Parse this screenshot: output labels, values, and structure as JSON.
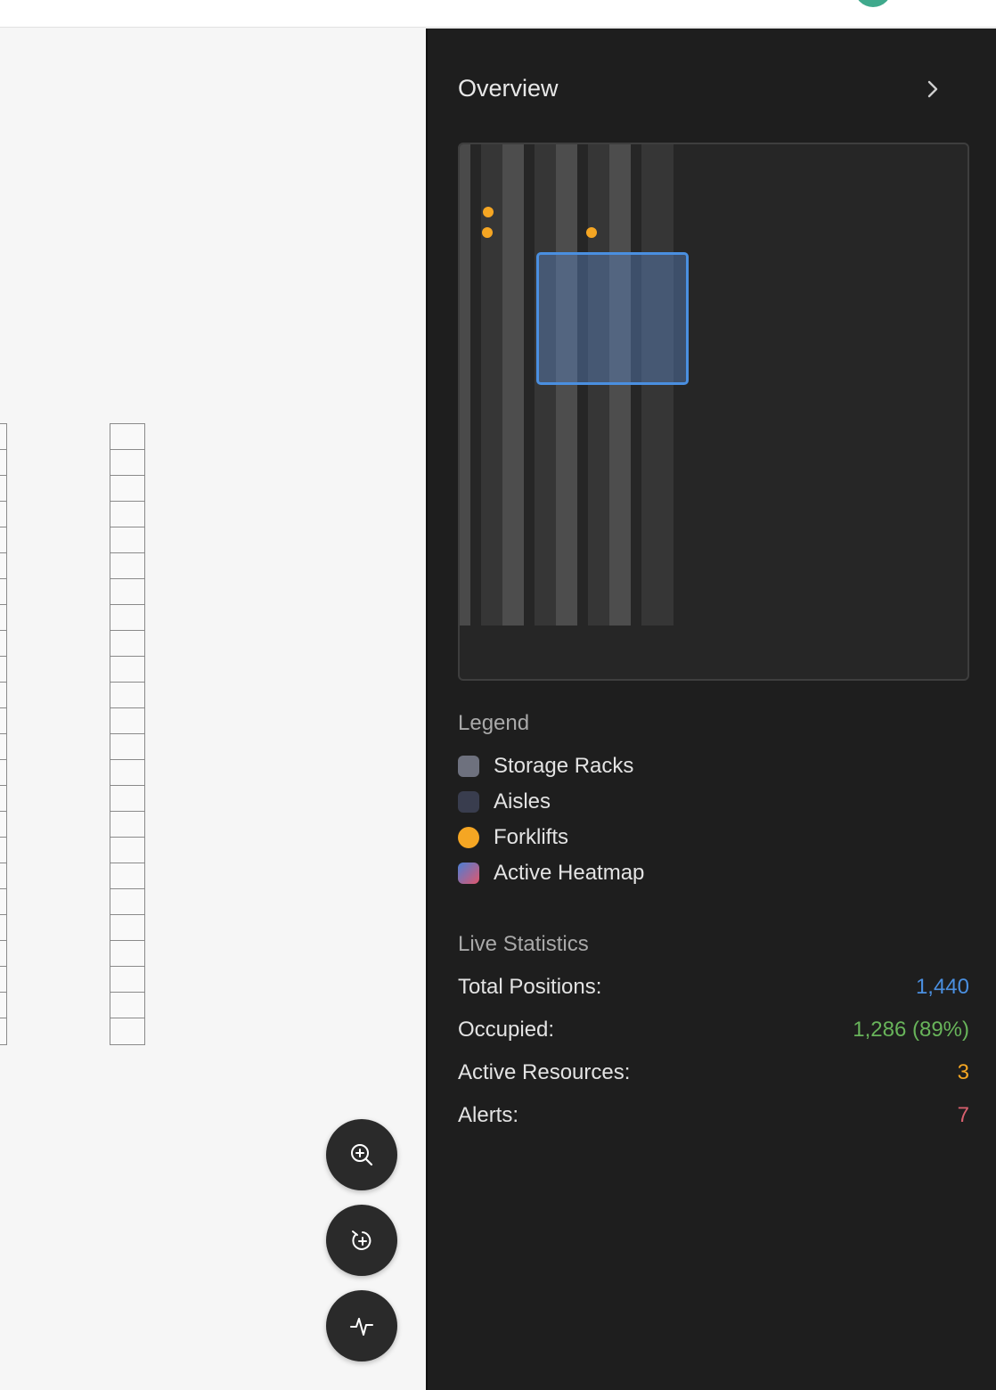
{
  "panel": {
    "title": "Overview"
  },
  "legend": {
    "heading": "Legend",
    "items": [
      {
        "label": "Storage Racks",
        "color": "#6e717e"
      },
      {
        "label": "Aisles",
        "color": "#393d4e"
      },
      {
        "label": "Forklifts",
        "color": "#f5a623"
      },
      {
        "label": "Active Heatmap",
        "color": "linear-gradient(135deg,#4a7fd6,#e0566d)"
      }
    ]
  },
  "stats": {
    "heading": "Live Statistics",
    "rows": [
      {
        "label": "Total Positions:",
        "value": "1,440",
        "color": "#4a8fe0"
      },
      {
        "label": "Occupied:",
        "value": "1,286 (89%)",
        "color": "#68b45a"
      },
      {
        "label": "Active Resources:",
        "value": "3",
        "color": "#f5a623"
      },
      {
        "label": "Alerts:",
        "value": "7",
        "color": "#d9606e"
      }
    ]
  },
  "controls": {
    "icons": [
      "zoom-in-icon",
      "recenter-icon",
      "activity-icon"
    ]
  },
  "colors": {
    "panel_bg": "#1e1e1e",
    "accent_blue": "#4a8fe0",
    "forklift": "#f5a623",
    "avatar": "#3fa98c"
  }
}
